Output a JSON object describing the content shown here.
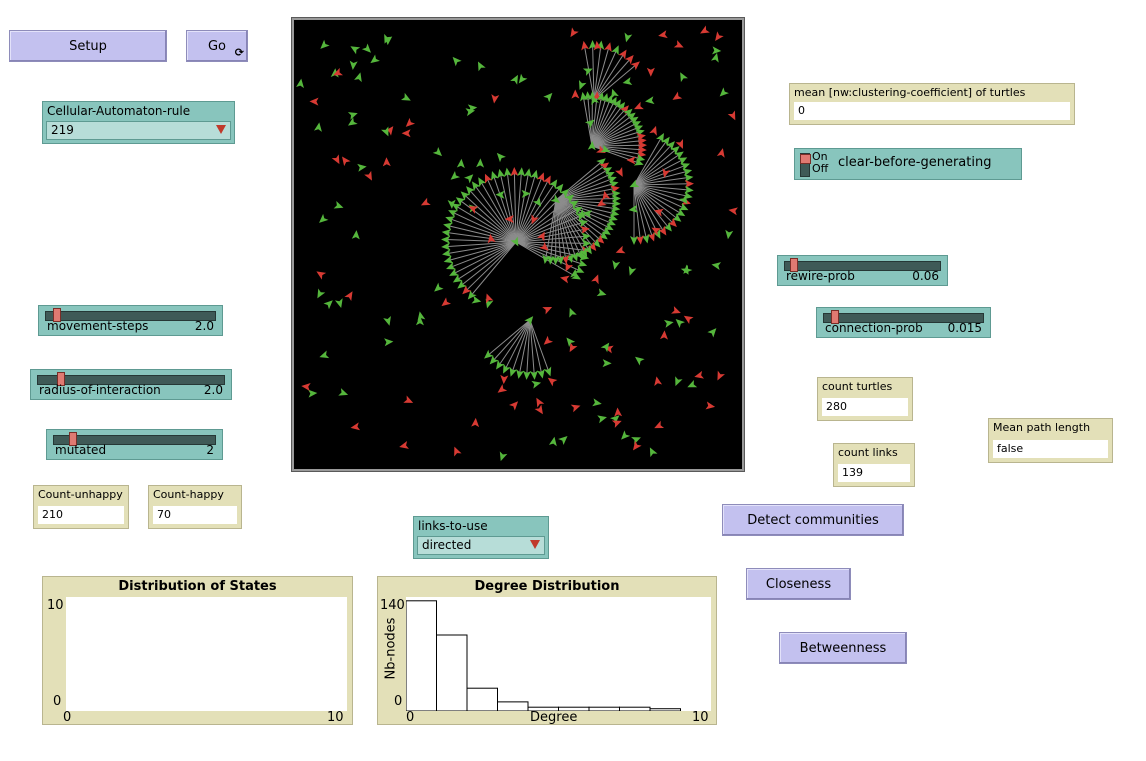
{
  "buttons": {
    "setup": "Setup",
    "go": "Go",
    "go_forever_glyph": "⟳",
    "detect_communities": "Detect communities",
    "closeness": "Closeness",
    "betweenness": "Betweenness"
  },
  "choosers": {
    "ca_rule": {
      "label": "Cellular-Automaton-rule",
      "value": "219"
    },
    "links_to_use": {
      "label": "links-to-use",
      "value": "directed"
    }
  },
  "sliders": {
    "movement_steps": {
      "name": "movement-steps",
      "value": "2.0",
      "fraction": 0.08
    },
    "radius_of_interaction": {
      "name": "radius-of-interaction",
      "value": "2.0",
      "fraction": 0.08
    },
    "mutated": {
      "name": "mutated",
      "value": "2",
      "fraction": 0.08
    },
    "rewire_prob": {
      "name": "rewire-prob",
      "value": "0.06",
      "fraction": 0.06
    },
    "connection_prob": {
      "name": "connection-prob",
      "value": "0.015",
      "fraction": 0.06
    }
  },
  "switch": {
    "label": "clear-before-generating",
    "on": "On",
    "off": "Off"
  },
  "monitors": {
    "clustering": {
      "label": "mean [nw:clustering-coefficient] of turtles",
      "value": "0"
    },
    "count_turtles": {
      "label": "count turtles",
      "value": "280"
    },
    "count_links": {
      "label": "count links",
      "value": "139"
    },
    "mean_path_length": {
      "label": "Mean path length",
      "value": "false"
    },
    "count_unhappy": {
      "label": "Count-unhappy",
      "value": "210"
    },
    "count_happy": {
      "label": "Count-happy",
      "value": "70"
    }
  },
  "plots": {
    "distribution_states": {
      "title": "Distribution of States",
      "y_max": "10",
      "y_min": "0",
      "x_min": "0",
      "x_max": "10"
    },
    "degree_distribution": {
      "title": "Degree Distribution",
      "y_max": "140",
      "y_min": "0",
      "x_min": "0",
      "x_max": "10",
      "xlabel": "Degree",
      "ylabel": "Nb-nodes"
    }
  },
  "chart_data": {
    "type": "bar",
    "title": "Degree Distribution",
    "xlabel": "Degree",
    "ylabel": "Nb-nodes",
    "categories": [
      "0",
      "1",
      "2",
      "3",
      "4",
      "5",
      "6",
      "7",
      "8",
      "9"
    ],
    "values": [
      145,
      100,
      30,
      12,
      5,
      5,
      5,
      5,
      3,
      0
    ],
    "xlim": [
      0,
      10
    ],
    "ylim": [
      0,
      150
    ]
  },
  "colors": {
    "green_agent": "#55b63c",
    "red_agent": "#d73a33",
    "link": "#8c8c8c",
    "button": "#c3c1ef",
    "widget_teal": "#88c5bd",
    "monitor": "#e3e0b8"
  }
}
